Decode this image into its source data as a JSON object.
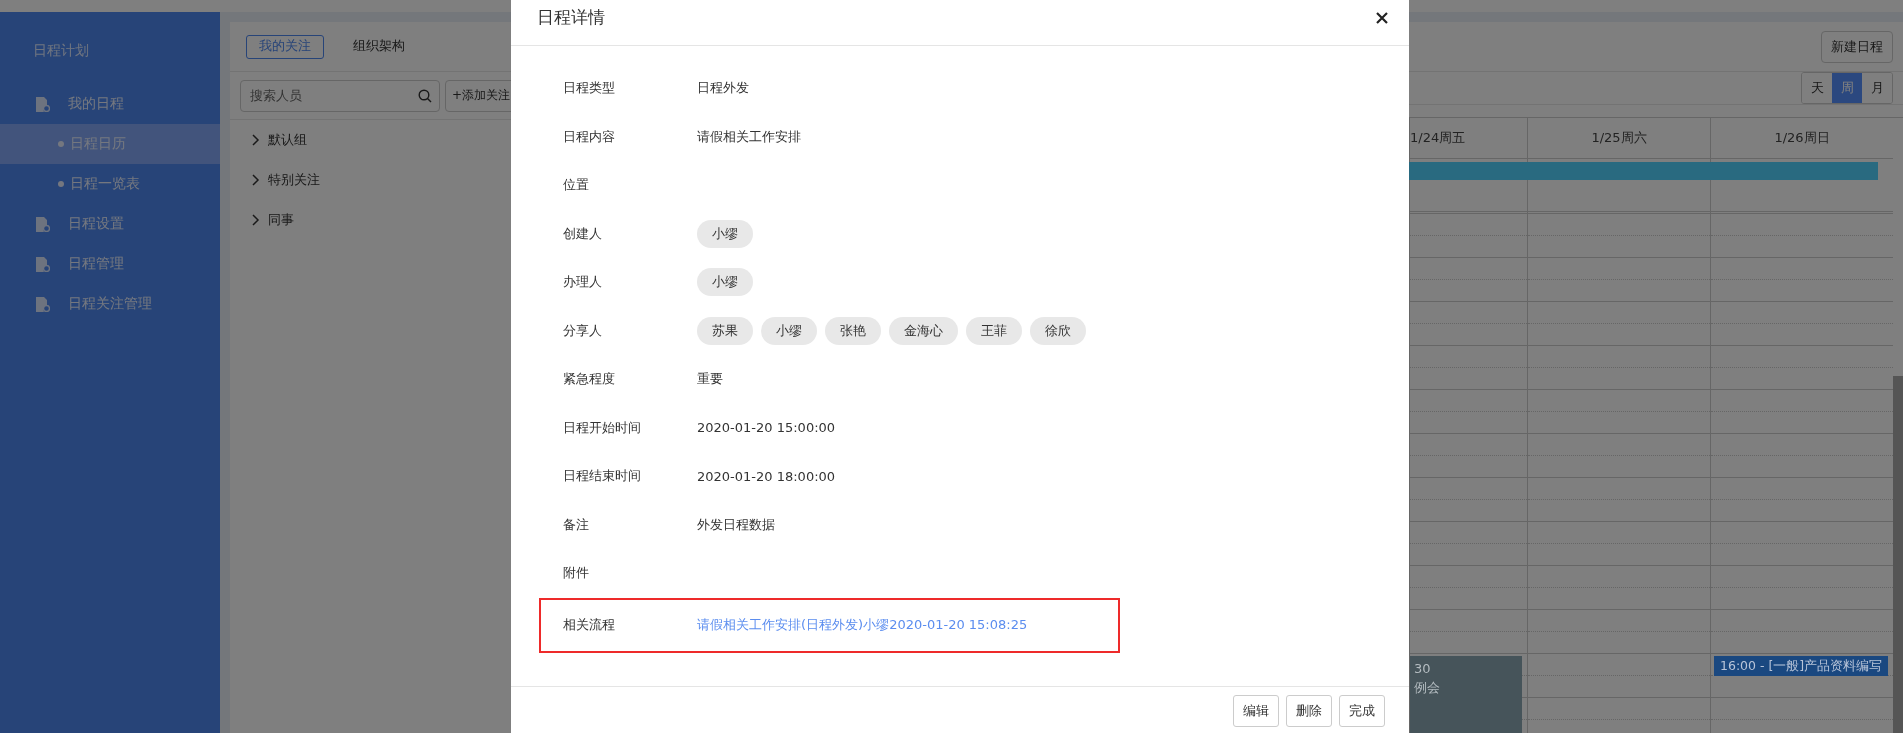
{
  "sidebar": {
    "title": "日程计划",
    "items": [
      {
        "label": "我的日程",
        "selected": false,
        "children": [
          {
            "label": "日程日历",
            "selected": true
          },
          {
            "label": "日程一览表",
            "selected": false
          }
        ]
      },
      {
        "label": "日程设置",
        "selected": false
      },
      {
        "label": "日程管理",
        "selected": false
      },
      {
        "label": "日程关注管理",
        "selected": false
      }
    ]
  },
  "follow_panel": {
    "tabs": [
      {
        "label": "我的关注",
        "selected": true
      },
      {
        "label": "组织架构",
        "selected": false
      }
    ],
    "search": {
      "placeholder": "搜索人员"
    },
    "add_button": "+添加关注",
    "groups": [
      {
        "label": "默认组",
        "expanded": false
      },
      {
        "label": "特别关注",
        "expanded": false
      },
      {
        "label": "同事",
        "expanded": false
      }
    ]
  },
  "toolbar": {
    "new_button": "新建日程",
    "views": [
      {
        "label": "天",
        "selected": false
      },
      {
        "label": "周",
        "selected": true
      },
      {
        "label": "月",
        "selected": false
      }
    ]
  },
  "calendar": {
    "days": [
      {
        "label": "1/24周五",
        "events": [
          {
            "time": "30",
            "title": "例会",
            "color": "#46545a"
          }
        ]
      },
      {
        "label": "1/25周六"
      },
      {
        "label": "1/26周日",
        "events": [
          {
            "title": "16:00 - [一般]产品资料编写",
            "color": "#1a4880"
          }
        ]
      }
    ],
    "all_day_events": [
      {
        "color": "#296a80"
      }
    ]
  },
  "modal": {
    "title": "日程详情",
    "fields": [
      {
        "label": "日程类型",
        "kind": "text",
        "value": "日程外发"
      },
      {
        "label": "日程内容",
        "kind": "text",
        "value": "请假相关工作安排"
      },
      {
        "label": "位置",
        "kind": "text"
      },
      {
        "label": "创建人",
        "kind": "people",
        "people": [
          "小缪"
        ]
      },
      {
        "label": "办理人",
        "kind": "people",
        "people": [
          "小缪"
        ]
      },
      {
        "label": "分享人",
        "kind": "people",
        "people": [
          "苏果",
          "小缪",
          "张艳",
          "金海心",
          "王菲",
          "徐欣"
        ]
      },
      {
        "label": "紧急程度",
        "kind": "text",
        "value": "重要"
      },
      {
        "label": "日程开始时间",
        "kind": "text",
        "value": "2020-01-20 15:00:00"
      },
      {
        "label": "日程结束时间",
        "kind": "text",
        "value": "2020-01-20 18:00:00"
      },
      {
        "label": "备注",
        "kind": "text",
        "value": "外发日程数据"
      },
      {
        "label": "附件",
        "kind": "text"
      },
      {
        "label": "相关流程",
        "kind": "link",
        "value": "请假相关工作安排(日程外发)小缪2020-01-20 15:08:25",
        "highlighted": true
      }
    ],
    "buttons": [
      "编辑",
      "删除",
      "完成"
    ]
  }
}
